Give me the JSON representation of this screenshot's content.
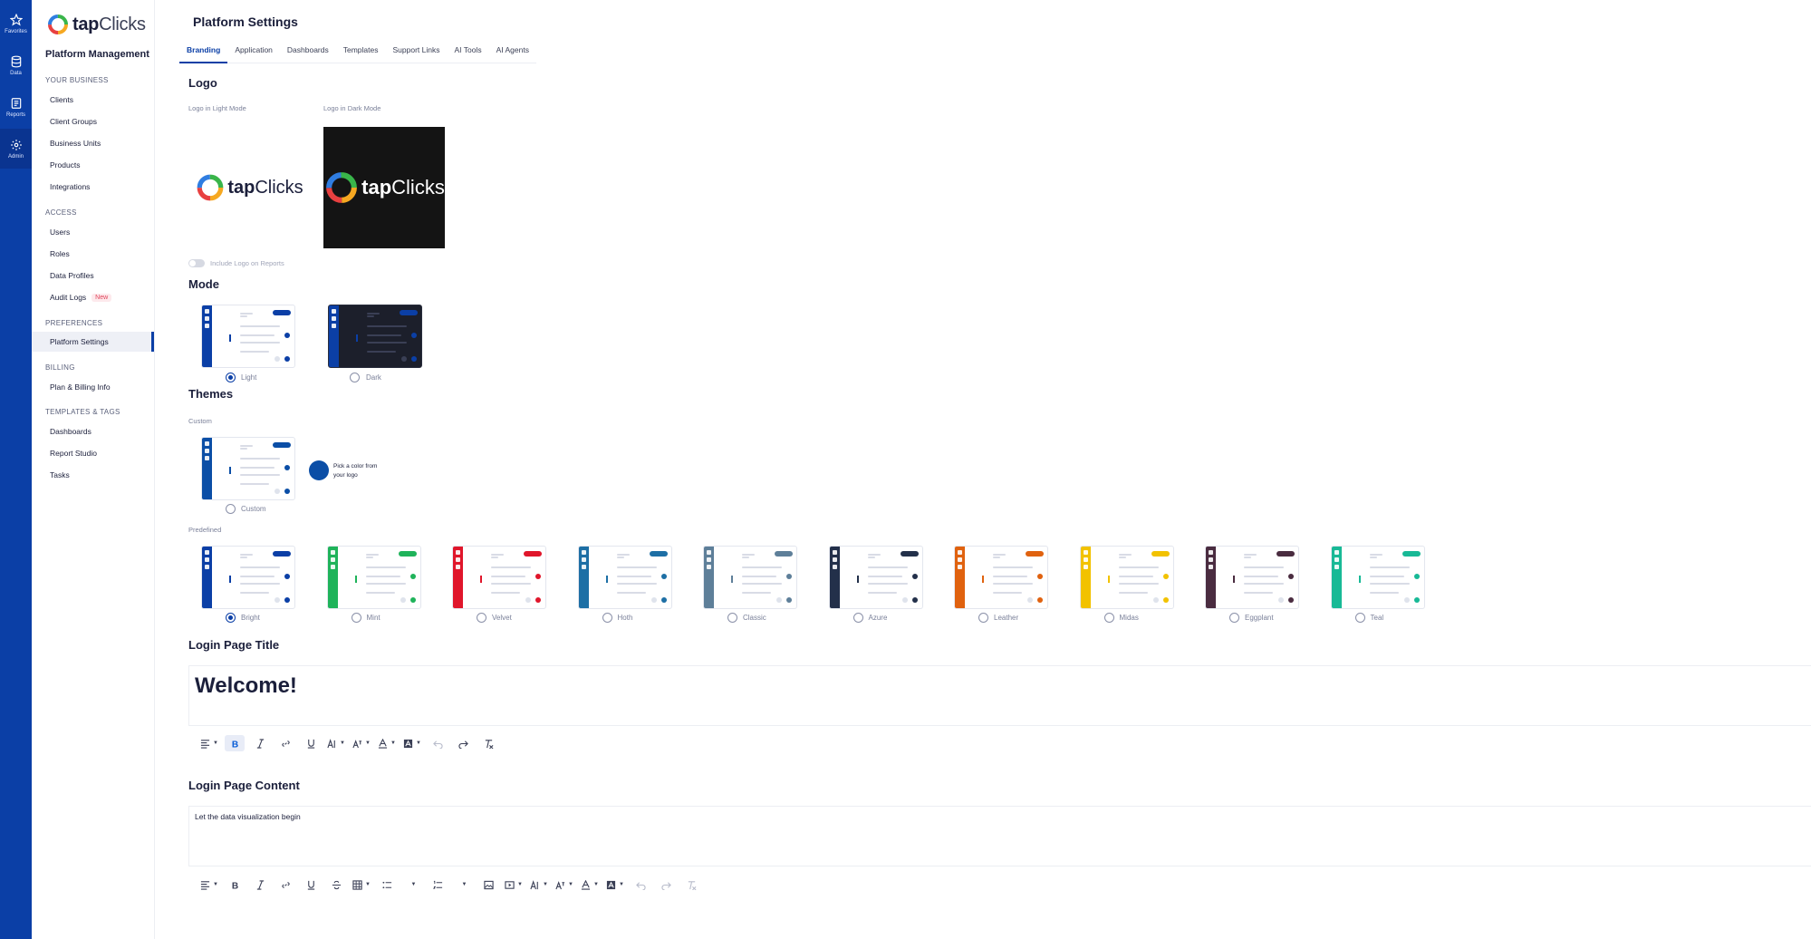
{
  "rail": [
    {
      "label": "Favorites",
      "icon": "star-icon"
    },
    {
      "label": "Data",
      "icon": "database-icon"
    },
    {
      "label": "Reports",
      "icon": "report-icon"
    },
    {
      "label": "Admin",
      "icon": "gear-icon"
    }
  ],
  "sidebar": {
    "logo_bold": "tap",
    "logo_light": "Clicks",
    "title": "Platform Management",
    "sections": {
      "your_business": "YOUR BUSINESS",
      "access": "ACCESS",
      "preferences": "PREFERENCES",
      "billing": "BILLING",
      "templates": "TEMPLATES & TAGS"
    },
    "items": {
      "clients": "Clients",
      "client_groups": "Client Groups",
      "business_units": "Business Units",
      "products": "Products",
      "integrations": "Integrations",
      "users": "Users",
      "roles": "Roles",
      "data_profiles": "Data Profiles",
      "audit_logs": "Audit Logs",
      "audit_badge": "New",
      "platform_settings": "Platform Settings",
      "plan_billing": "Plan & Billing Info",
      "dashboards": "Dashboards",
      "report_studio": "Report Studio",
      "tasks": "Tasks"
    }
  },
  "main": {
    "title": "Platform Settings",
    "tabs": [
      "Branding",
      "Application",
      "Dashboards",
      "Templates",
      "Support Links",
      "AI Tools",
      "AI Agents"
    ],
    "logo": {
      "heading": "Logo",
      "light_label": "Logo in Light Mode",
      "dark_label": "Logo in Dark Mode",
      "include_toggle": "Include Logo on Reports"
    },
    "mode": {
      "heading": "Mode",
      "light": "Light",
      "dark": "Dark"
    },
    "themes": {
      "heading": "Themes",
      "custom_label": "Custom",
      "custom_option": "Custom",
      "pick_color": "Pick a color from your logo",
      "predefined_label": "Predefined",
      "options": [
        {
          "name": "Bright",
          "color": "#0b3fa6"
        },
        {
          "name": "Mint",
          "color": "#1fb35a"
        },
        {
          "name": "Velvet",
          "color": "#e0162b"
        },
        {
          "name": "Hoth",
          "color": "#1d6fa5"
        },
        {
          "name": "Classic",
          "color": "#5e7f99"
        },
        {
          "name": "Azure",
          "color": "#23304a"
        },
        {
          "name": "Leather",
          "color": "#e0620f"
        },
        {
          "name": "Midas",
          "color": "#f2c200"
        },
        {
          "name": "Eggplant",
          "color": "#4a2c40"
        },
        {
          "name": "Teal",
          "color": "#18b996"
        }
      ]
    },
    "login_title": {
      "heading": "Login Page Title",
      "value": "Welcome!"
    },
    "login_content": {
      "heading": "Login Page Content",
      "value": "Let the data visualization begin"
    }
  },
  "colors": {
    "accent": "#0b3fa6",
    "custom_swatch": "#0b4ea6"
  }
}
